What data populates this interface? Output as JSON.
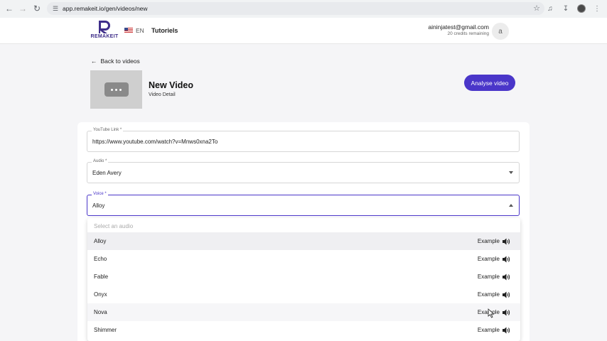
{
  "browser": {
    "url": "app.remakeit.io/gen/videos/new"
  },
  "header": {
    "logo_text": "REMAKEIT",
    "lang": "EN",
    "tutorials": "Tutoriels",
    "email": "aininjatest@gmail.com",
    "credits": "20 credits remaining",
    "avatar_letter": "a"
  },
  "page": {
    "back_label": "Back to videos",
    "title": "New Video",
    "subtitle": "Video Detail",
    "analyse_label": "Analyse video"
  },
  "form": {
    "youtube": {
      "label": "YouTube Link *",
      "value": "https://www.youtube.com/watch?v=Mnws0xna2To"
    },
    "audio": {
      "label": "Audio *",
      "value": "Eden Avery"
    },
    "voice": {
      "label": "Voice *",
      "value": "Alloy"
    }
  },
  "dropdown": {
    "placeholder": "Select an audio",
    "example_label": "Example",
    "options": [
      "Alloy",
      "Echo",
      "Fable",
      "Onyx",
      "Nova",
      "Shimmer"
    ]
  },
  "colors": {
    "accent": "#4a36c9",
    "logo": "#3f2e8a"
  }
}
